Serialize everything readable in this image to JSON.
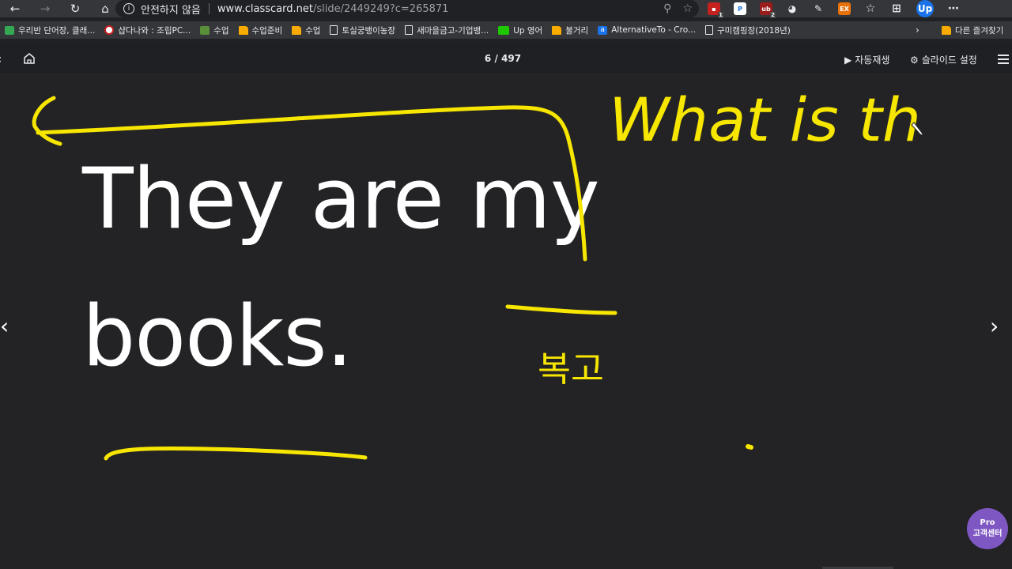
{
  "browser": {
    "security_label": "안전하지 않음",
    "url_host": "www.classcard.net",
    "url_path": "/slide/2449249?c=265871",
    "profile_initials": "Up",
    "ext_badges": [
      "1",
      "2"
    ]
  },
  "bookmarks": {
    "items": [
      {
        "label": "우리반 단어장, 클래...",
        "icon": "green-app-icon"
      },
      {
        "label": "샵다나와 : 조립PC...",
        "icon": "danawa-icon"
      },
      {
        "label": "수업",
        "icon": "image-icon"
      },
      {
        "label": "수업준비",
        "icon": "folder-icon"
      },
      {
        "label": "수업",
        "icon": "folder-icon"
      },
      {
        "label": "토실궁뱅이농장",
        "icon": "page-icon"
      },
      {
        "label": "새마을금고-기업뱅...",
        "icon": "page-icon"
      },
      {
        "label": "Up 영어",
        "icon": "line-icon"
      },
      {
        "label": "불거리",
        "icon": "folder-icon"
      },
      {
        "label": "AlternativeTo - Cro...",
        "icon": "alternativeto-icon"
      },
      {
        "label": "구미캠핑장(2018년)",
        "icon": "page-icon"
      }
    ],
    "other_label": "다른 즐겨찾기"
  },
  "toolbar": {
    "slide_counter": "6 / 497",
    "autoplay_label": "자동재생",
    "settings_label": "슬라이드 설정"
  },
  "slide": {
    "line1": "They are my",
    "line2": "books."
  },
  "annotations": {
    "handwriting_top": "What is th",
    "handwriting_note": "복고"
  },
  "support_badge": {
    "line1": "Pro",
    "line2": "고객센터"
  },
  "colors": {
    "ink": "#f7e600",
    "support_badge": "#7e57c2",
    "background": "#232326"
  }
}
